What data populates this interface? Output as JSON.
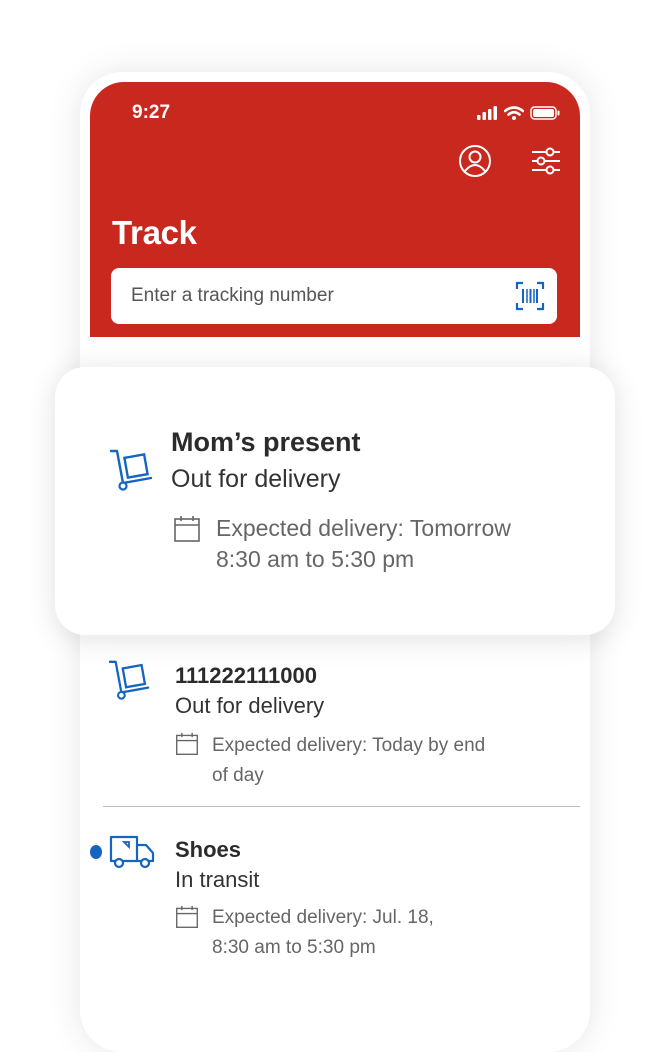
{
  "status_bar": {
    "time": "9:27"
  },
  "header": {
    "title": "Track",
    "icons": [
      "profile-icon",
      "filter-settings-icon"
    ]
  },
  "search": {
    "placeholder": "Enter a tracking number",
    "scan_icon": "barcode-scan-icon"
  },
  "featured": {
    "icon": "hand-truck-package-icon",
    "title": "Mom’s present",
    "status": "Out for delivery",
    "expected_line1": "Expected delivery: Tomorrow",
    "expected_line2": "8:30 am to 5:30 pm"
  },
  "shipments": [
    {
      "icon": "hand-truck-package-icon",
      "title": "111222111000",
      "status": "Out for delivery",
      "expected_line1": "Expected delivery: Today by end",
      "expected_line2": "of day"
    },
    {
      "icon": "delivery-truck-icon",
      "title": "Shoes",
      "status": "In transit",
      "expected_line1": "Expected delivery: Jul. 18,",
      "expected_line2": "8:30 am to 5:30 pm",
      "unread": true
    }
  ],
  "colors": {
    "brand_red": "#c8281e",
    "accent_blue": "#1565c0"
  }
}
